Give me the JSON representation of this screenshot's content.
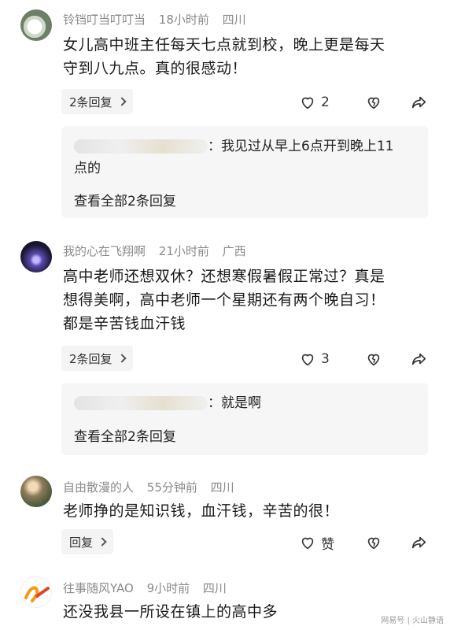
{
  "comments": [
    {
      "username": "铃铛叮当叮叮当",
      "time": "18小时前",
      "location": "四川",
      "text_lines": [
        "女儿高中班主任每天七点就到校，晚上更是每天",
        "守到八九点。真的很感动！"
      ],
      "reply_button": "2条回复",
      "like_count": "2",
      "sub_reply": {
        "text_line1": "：我见过从早上6点开到晚上11",
        "text_line2": "点的",
        "view_all": "查看全部2条回复"
      }
    },
    {
      "username": "我的心在飞翔啊",
      "time": "21小时前",
      "location": "广西",
      "text_lines": [
        "高中老师还想双休？还想寒假暑假正常过？真是",
        "想得美啊，高中老师一个星期还有两个晚自习！",
        "都是辛苦钱血汗钱"
      ],
      "reply_button": "2条回复",
      "like_count": "3",
      "sub_reply": {
        "text_line1": "：就是啊",
        "view_all": "查看全部2条回复"
      }
    },
    {
      "username": "自由散漫的人",
      "time": "55分钟前",
      "location": "四川",
      "text_lines": [
        "老师挣的是知识钱，血汗钱，辛苦的很！"
      ],
      "reply_button": "回复",
      "like_label": "赞"
    },
    {
      "username": "往事随风YAO",
      "time": "9小时前",
      "location": "四川",
      "text_lines": [
        "还没我县一所设在镇上的高中多"
      ]
    }
  ],
  "watermark": "网易号 | 火山静语",
  "colors": {
    "meta": "#8a8a8a",
    "text": "#1a1a1a",
    "box": "#f6f6f6",
    "pill": "#f4f4f4"
  }
}
